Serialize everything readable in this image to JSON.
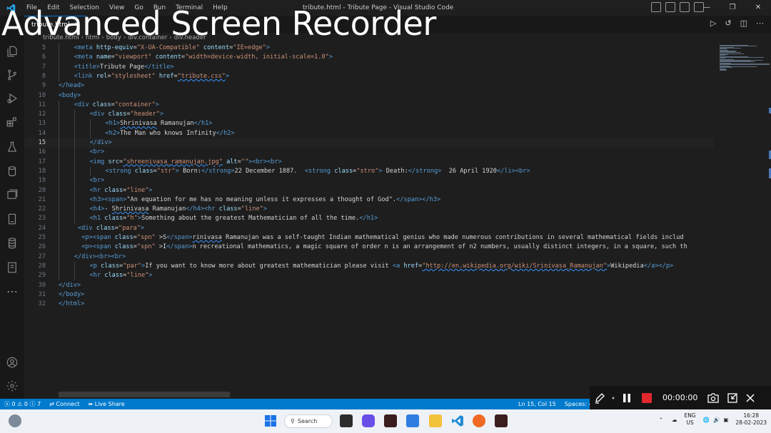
{
  "watermark": "Advanced Screen Recorder",
  "window": {
    "title": "tribute.html - Tribute Page - Visual Studio Code",
    "menu": [
      "File",
      "Edit",
      "Selection",
      "View",
      "Go",
      "Run",
      "Terminal",
      "Help"
    ]
  },
  "tab": {
    "label": "tribute.html"
  },
  "breadcrumb": [
    "tribute.html",
    "html",
    "body",
    "div.container",
    "div.header"
  ],
  "editor": {
    "current_line": 15,
    "lines": [
      {
        "n": 5,
        "indent": 1,
        "tokens": [
          [
            "t",
            "<meta "
          ],
          [
            "a",
            "http-equiv"
          ],
          [
            "x",
            "="
          ],
          [
            "s",
            "\"X-UA-Compatible\""
          ],
          [
            "a",
            " content"
          ],
          [
            "x",
            "="
          ],
          [
            "s",
            "\"IE=edge\""
          ],
          [
            "t",
            ">"
          ]
        ]
      },
      {
        "n": 6,
        "indent": 1,
        "tokens": [
          [
            "t",
            "<meta "
          ],
          [
            "a",
            "name"
          ],
          [
            "x",
            "="
          ],
          [
            "s",
            "\"viewport\""
          ],
          [
            "a",
            " content"
          ],
          [
            "x",
            "="
          ],
          [
            "s",
            "\"width=device-width, initial-scale=1.0\""
          ],
          [
            "t",
            ">"
          ]
        ]
      },
      {
        "n": 7,
        "indent": 1,
        "tokens": [
          [
            "t",
            "<title>"
          ],
          [
            "x",
            "Tribute Page"
          ],
          [
            "t",
            "</title>"
          ]
        ]
      },
      {
        "n": 8,
        "indent": 1,
        "tokens": [
          [
            "t",
            "<link "
          ],
          [
            "a",
            "rel"
          ],
          [
            "x",
            "="
          ],
          [
            "s",
            "\"stylesheet\""
          ],
          [
            "a",
            " href"
          ],
          [
            "x",
            "="
          ],
          [
            "su",
            "\"tribute.css\""
          ],
          [
            "t",
            ">"
          ]
        ]
      },
      {
        "n": 9,
        "indent": 0,
        "tokens": [
          [
            "t",
            "</head>"
          ]
        ]
      },
      {
        "n": 10,
        "indent": 0,
        "tokens": [
          [
            "t",
            "<body>"
          ]
        ]
      },
      {
        "n": 11,
        "indent": 1,
        "tokens": [
          [
            "t",
            "<div "
          ],
          [
            "a",
            "class"
          ],
          [
            "x",
            "="
          ],
          [
            "s",
            "\"container\""
          ],
          [
            "t",
            ">"
          ]
        ]
      },
      {
        "n": 12,
        "indent": 2,
        "tokens": [
          [
            "t",
            "<div "
          ],
          [
            "a",
            "class"
          ],
          [
            "x",
            "="
          ],
          [
            "s",
            "\"header\""
          ],
          [
            "t",
            ">"
          ]
        ]
      },
      {
        "n": 13,
        "indent": 3,
        "tokens": [
          [
            "t",
            "<h1>"
          ],
          [
            "xu",
            "Shrinivasa"
          ],
          [
            "x",
            " Ramanujan"
          ],
          [
            "t",
            "</h1>"
          ]
        ]
      },
      {
        "n": 14,
        "indent": 3,
        "tokens": [
          [
            "t",
            "<h2>"
          ],
          [
            "x",
            "The Man who knows Infinity"
          ],
          [
            "t",
            "</h2>"
          ]
        ]
      },
      {
        "n": 15,
        "indent": 2,
        "tokens": [
          [
            "t",
            "</div>"
          ]
        ]
      },
      {
        "n": 16,
        "indent": 2,
        "tokens": [
          [
            "t",
            "<br>"
          ]
        ]
      },
      {
        "n": 17,
        "indent": 2,
        "tokens": [
          [
            "t",
            "<img "
          ],
          [
            "a",
            "src"
          ],
          [
            "x",
            "="
          ],
          [
            "su",
            "\"shreenivasa_ramanujan.jpg\""
          ],
          [
            "a",
            " alt"
          ],
          [
            "x",
            "="
          ],
          [
            "s",
            "\"\""
          ],
          [
            "t",
            ">"
          ],
          [
            "t",
            "<br>"
          ],
          [
            "t",
            "<br>"
          ]
        ]
      },
      {
        "n": 18,
        "indent": 3,
        "tokens": [
          [
            "t",
            "<strong "
          ],
          [
            "a",
            "class"
          ],
          [
            "x",
            "="
          ],
          [
            "s",
            "\"str\""
          ],
          [
            "t",
            ">"
          ],
          [
            "x",
            " Born:"
          ],
          [
            "t",
            "</strong>"
          ],
          [
            "x",
            "22 December 1887.  "
          ],
          [
            "t",
            "<strong "
          ],
          [
            "a",
            "class"
          ],
          [
            "x",
            "="
          ],
          [
            "s",
            "\"stro\""
          ],
          [
            "t",
            ">"
          ],
          [
            "x",
            " Death:"
          ],
          [
            "t",
            "</strong>"
          ],
          [
            "x",
            "  26 April 1920"
          ],
          [
            "t",
            "</li>"
          ],
          [
            "t",
            "<br>"
          ]
        ]
      },
      {
        "n": 19,
        "indent": 2,
        "tokens": [
          [
            "t",
            "<br>"
          ]
        ]
      },
      {
        "n": 20,
        "indent": 2,
        "tokens": [
          [
            "t",
            "<hr "
          ],
          [
            "a",
            "class"
          ],
          [
            "x",
            "="
          ],
          [
            "s",
            "\"line\""
          ],
          [
            "t",
            ">"
          ]
        ]
      },
      {
        "n": 21,
        "indent": 2,
        "tokens": [
          [
            "t",
            "<h3>"
          ],
          [
            "t",
            "<span>"
          ],
          [
            "x",
            "\"An equation for me has no meaning unless it expresses a thought of God\"."
          ],
          [
            "t",
            "</span>"
          ],
          [
            "t",
            "</h3>"
          ]
        ]
      },
      {
        "n": 22,
        "indent": 2,
        "tokens": [
          [
            "t",
            "<h4>"
          ],
          [
            "x",
            "- "
          ],
          [
            "xu",
            "Shrinivasa"
          ],
          [
            "x",
            " Ramanujan"
          ],
          [
            "t",
            "</h4>"
          ],
          [
            "t",
            "<hr "
          ],
          [
            "a",
            "class"
          ],
          [
            "x",
            "="
          ],
          [
            "s",
            "\"line\""
          ],
          [
            "t",
            ">"
          ]
        ]
      },
      {
        "n": 23,
        "indent": 2,
        "tokens": [
          [
            "t",
            "<h1 "
          ],
          [
            "a",
            "class"
          ],
          [
            "x",
            "="
          ],
          [
            "s",
            "\"h\""
          ],
          [
            "t",
            ">"
          ],
          [
            "x",
            "Something about the greatest Mathematician of all the time."
          ],
          [
            "t",
            "</h1>"
          ]
        ]
      },
      {
        "n": 24,
        "indent": 1,
        "pad": 1,
        "tokens": [
          [
            "t",
            "<div "
          ],
          [
            "a",
            "class"
          ],
          [
            "x",
            "="
          ],
          [
            "s",
            "\"para\""
          ],
          [
            "t",
            ">"
          ]
        ]
      },
      {
        "n": 25,
        "indent": 1,
        "pad": 2,
        "tokens": [
          [
            "t",
            "<p>"
          ],
          [
            "t",
            "<span "
          ],
          [
            "a",
            "class"
          ],
          [
            "x",
            "="
          ],
          [
            "s",
            "\"spn\""
          ],
          [
            "x",
            " >S"
          ],
          [
            "t",
            "</span>"
          ],
          [
            "xu",
            "rinivasa"
          ],
          [
            "x",
            " Ramanujan was a self-taught Indian mathematical genius who made numerous contributions in several mathematical fields includ"
          ]
        ]
      },
      {
        "n": 26,
        "indent": 1,
        "pad": 2,
        "tokens": [
          [
            "t",
            "<p>"
          ],
          [
            "t",
            "<span "
          ],
          [
            "a",
            "class"
          ],
          [
            "x",
            "="
          ],
          [
            "s",
            "\"spn\""
          ],
          [
            "x",
            " >I"
          ],
          [
            "t",
            "</span>"
          ],
          [
            "x",
            "n recreational mathematics, a magic square of order n is an arrangement of n2 numbers, usually distinct integers, in a square, such th"
          ]
        ]
      },
      {
        "n": 27,
        "indent": 1,
        "tokens": [
          [
            "t",
            "</div>"
          ],
          [
            "t",
            "<br>"
          ],
          [
            "t",
            "<br>"
          ]
        ]
      },
      {
        "n": 28,
        "indent": 2,
        "tokens": [
          [
            "t",
            "<p "
          ],
          [
            "a",
            "class"
          ],
          [
            "x",
            "="
          ],
          [
            "s",
            "\"par\""
          ],
          [
            "t",
            ">"
          ],
          [
            "x",
            "If you want to know more about greatest mathematician please visit "
          ],
          [
            "t",
            "<a "
          ],
          [
            "a",
            "href"
          ],
          [
            "x",
            "="
          ],
          [
            "su",
            "\"http://en.wikipedia.org/wiki/Srinivasa_Ramanujan\""
          ],
          [
            "t",
            ">"
          ],
          [
            "x",
            "Wikipedia"
          ],
          [
            "t",
            "</a>"
          ],
          [
            "t",
            "</p>"
          ]
        ]
      },
      {
        "n": 29,
        "indent": 2,
        "tokens": [
          [
            "t",
            "<hr "
          ],
          [
            "a",
            "class"
          ],
          [
            "x",
            "="
          ],
          [
            "s",
            "\"line\""
          ],
          [
            "t",
            ">"
          ]
        ]
      },
      {
        "n": 30,
        "indent": 0,
        "tokens": [
          [
            "t",
            "</div>"
          ]
        ]
      },
      {
        "n": 31,
        "indent": 0,
        "tokens": [
          [
            "t",
            "</body>"
          ]
        ]
      },
      {
        "n": 32,
        "indent": 0,
        "tokens": [
          [
            "t",
            "</html>"
          ]
        ]
      }
    ]
  },
  "statusbar": {
    "problems": "ⓧ 0 ⚠ 0 ⓘ 7",
    "connect": "Connect",
    "live_share": "Live Share",
    "position": "Ln 15, Col 15",
    "spaces": "Spaces: 4"
  },
  "recorder": {
    "time": "00:00:00"
  },
  "taskbar": {
    "search": "Search",
    "lang_top": "ENG",
    "lang_bottom": "US",
    "time": "16:28",
    "date": "28-02-2023"
  },
  "colors": {
    "accent": "#007acc",
    "record": "#e0282e",
    "tag": "#569cd6",
    "attr": "#9cdcfe",
    "string": "#ce9178"
  }
}
